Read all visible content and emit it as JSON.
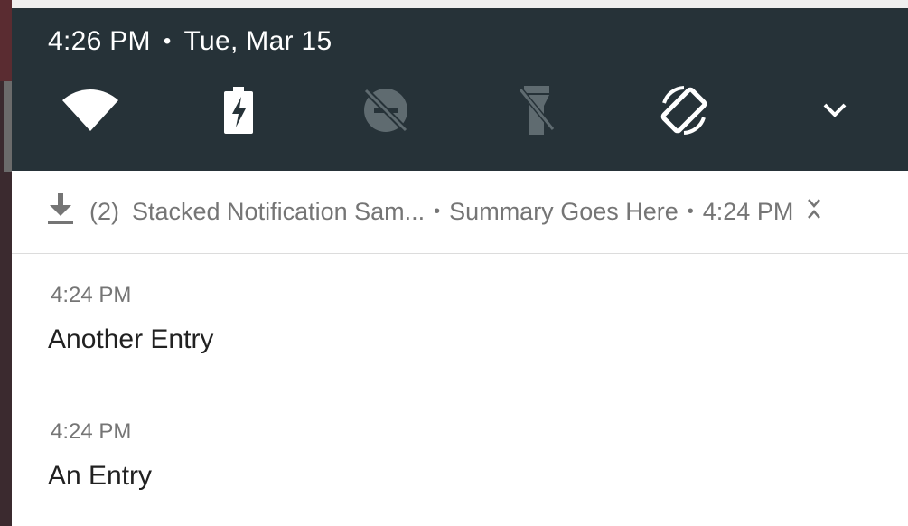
{
  "status_bar": {
    "time": "4:26 PM",
    "separator": "•",
    "date": "Tue, Mar 15"
  },
  "quick_settings": [
    {
      "name": "wifi",
      "icon": "wifi-icon",
      "active": true
    },
    {
      "name": "battery-saver",
      "icon": "battery-charging-icon",
      "active": true
    },
    {
      "name": "do-not-disturb",
      "icon": "dnd-off-icon",
      "active": false
    },
    {
      "name": "flashlight",
      "icon": "flashlight-off-icon",
      "active": false
    },
    {
      "name": "auto-rotate",
      "icon": "screen-rotation-icon",
      "active": true
    },
    {
      "name": "expand",
      "icon": "chevron-down-icon",
      "active": true
    }
  ],
  "notification_group": {
    "icon": "download-icon",
    "count": "(2)",
    "app_name": "Stacked Notification Sam...",
    "summary": "Summary Goes Here",
    "time": "4:24 PM",
    "separator": "•",
    "expand_icon": "collapse-icon"
  },
  "entries": [
    {
      "time": "4:24 PM",
      "title": "Another Entry"
    },
    {
      "time": "4:24 PM",
      "title": "An Entry"
    }
  ],
  "colors": {
    "shade": "#263238",
    "active_icon": "#ffffff",
    "inactive_icon": "#5f6b70",
    "secondary_text": "#757575",
    "primary_text": "#212121"
  }
}
